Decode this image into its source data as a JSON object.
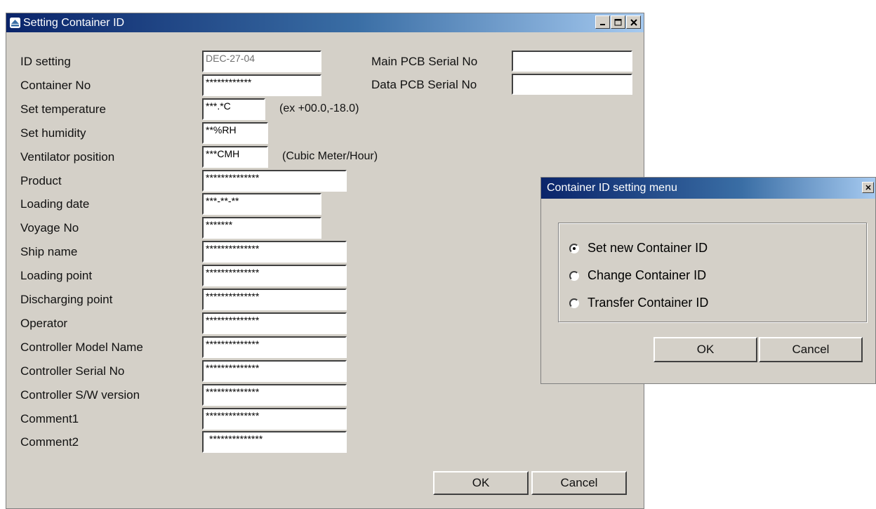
{
  "main_window": {
    "title": "Setting Container ID",
    "right_fields": [
      {
        "label": "Main PCB Serial No",
        "value": ""
      },
      {
        "label": "Data PCB Serial No",
        "value": ""
      }
    ],
    "fields": [
      {
        "label": "ID setting",
        "value": "DEC-27-04",
        "hint": ""
      },
      {
        "label": "Container No",
        "value": "************",
        "hint": ""
      },
      {
        "label": "Set temperature",
        "value": "***.*C",
        "hint": "(ex +00.0,-18.0)"
      },
      {
        "label": "Set humidity",
        "value": "**%RH",
        "hint": ""
      },
      {
        "label": "Ventilator position",
        "value": "***CMH",
        "hint": "(Cubic Meter/Hour)"
      },
      {
        "label": "Product",
        "value": "**************",
        "hint": ""
      },
      {
        "label": "Loading date",
        "value": "***-**-**",
        "hint": ""
      },
      {
        "label": "Voyage No",
        "value": "*******",
        "hint": ""
      },
      {
        "label": "Ship name",
        "value": "**************",
        "hint": ""
      },
      {
        "label": "Loading point",
        "value": "**************",
        "hint": ""
      },
      {
        "label": "Discharging point",
        "value": "**************",
        "hint": ""
      },
      {
        "label": "Operator",
        "value": "**************",
        "hint": ""
      },
      {
        "label": "Controller Model Name",
        "value": "**************",
        "hint": ""
      },
      {
        "label": "Controller Serial No",
        "value": "**************",
        "hint": ""
      },
      {
        "label": "Controller S/W version",
        "value": "**************",
        "hint": ""
      },
      {
        "label": "Comment1",
        "value": "**************",
        "hint": ""
      },
      {
        "label": "Comment2",
        "value": "**************",
        "hint": ""
      }
    ],
    "ok_label": "OK",
    "cancel_label": "Cancel"
  },
  "menu_dialog": {
    "title": "Container ID setting menu",
    "options": [
      {
        "label": "Set new Container ID",
        "selected": true
      },
      {
        "label": "Change Container ID",
        "selected": false
      },
      {
        "label": "Transfer Container ID",
        "selected": false
      }
    ],
    "ok_label": "OK",
    "cancel_label": "Cancel"
  },
  "colors": {
    "titlebar": "#0a246a",
    "window_bg": "#d4d0c8"
  }
}
